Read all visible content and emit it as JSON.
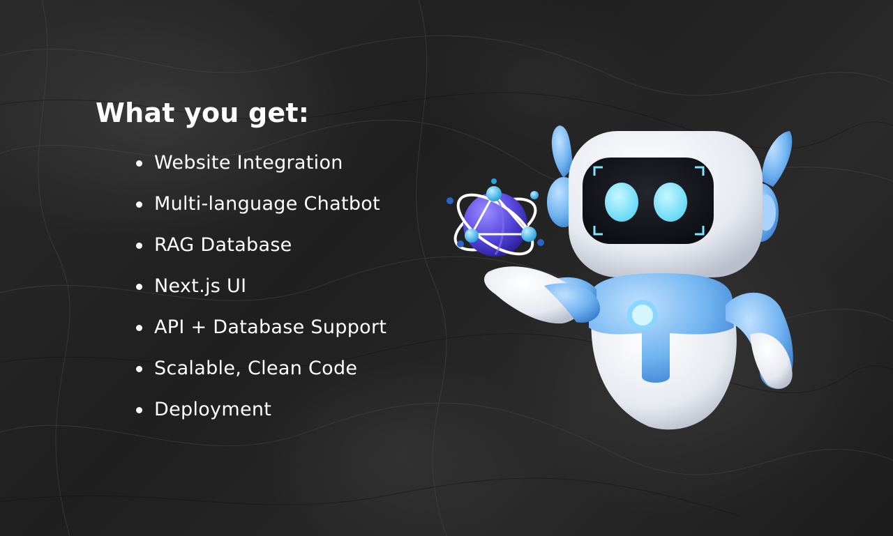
{
  "heading": "What you get:",
  "features": [
    "Website Integration",
    "Multi-language Chatbot",
    "RAG Database",
    "Next.js UI",
    "API + Database Support",
    "Scalable, Clean Code",
    "Deployment"
  ],
  "illustration": {
    "subject": "robot-holding-atom-icon",
    "colors": {
      "body": "#f2f4f8",
      "accent_blue": "#6fb3f0",
      "visor": "#15171c",
      "eyes": "#7fe6ff",
      "atom_core": "#5a4ae0"
    }
  },
  "colors": {
    "background": "#262626",
    "text": "#ffffff"
  }
}
